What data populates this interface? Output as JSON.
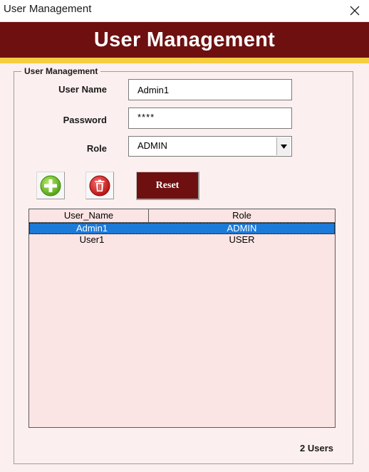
{
  "window": {
    "title": "User Management"
  },
  "header": {
    "title": "User Management"
  },
  "form": {
    "group_label": "User Management",
    "username_label": "User Name",
    "username_value": "Admin1",
    "password_label": "Password",
    "password_value": "****",
    "role_label": "Role",
    "role_value": "ADMIN"
  },
  "toolbar": {
    "reset_label": "Reset"
  },
  "table": {
    "columns": [
      "User_Name",
      "Role"
    ],
    "rows": [
      {
        "user": "Admin1",
        "role": "ADMIN",
        "selected": true
      },
      {
        "user": "User1",
        "role": "USER",
        "selected": false
      }
    ]
  },
  "footer": {
    "count": "2 Users"
  },
  "colors": {
    "brand": "#6e1010",
    "accent_bar": "#f6cd40",
    "selection": "#1c7ad8",
    "panel_bg": "#fcefef",
    "add_icon": "#6cbf1e",
    "delete_icon": "#d01c1c"
  },
  "icons": {
    "close": "close-icon",
    "add": "add-user-icon",
    "delete": "delete-user-icon",
    "dropdown": "chevron-down-icon"
  }
}
